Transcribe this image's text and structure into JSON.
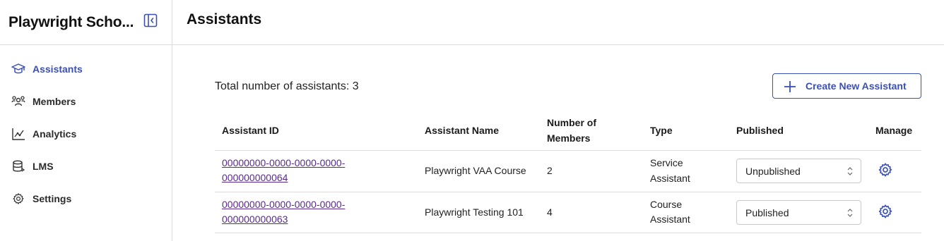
{
  "sidebar": {
    "org_name": "Playwright Scho...",
    "items": [
      {
        "label": "Assistants",
        "icon": "graduation-cap-icon",
        "active": true
      },
      {
        "label": "Members",
        "icon": "users-icon",
        "active": false
      },
      {
        "label": "Analytics",
        "icon": "chart-icon",
        "active": false
      },
      {
        "label": "LMS",
        "icon": "database-icon",
        "active": false
      },
      {
        "label": "Settings",
        "icon": "gear-icon",
        "active": false
      }
    ]
  },
  "header": {
    "title": "Assistants"
  },
  "main": {
    "total_text": "Total number of assistants: 3",
    "create_button_label": "Create New Assistant",
    "table": {
      "headers": {
        "id": "Assistant ID",
        "name": "Assistant Name",
        "members_line1": "Number of",
        "members_line2": "Members",
        "type": "Type",
        "published": "Published",
        "manage": "Manage"
      },
      "rows": [
        {
          "id_line1": "00000000-0000-0000-0000-",
          "id_line2": "000000000064",
          "name": "Playwright VAA Course",
          "members": "2",
          "type_line1": "Service",
          "type_line2": "Assistant",
          "published": "Unpublished"
        },
        {
          "id_line1": "00000000-0000-0000-0000-",
          "id_line2": "000000000063",
          "name": "Playwright Testing 101",
          "members": "4",
          "type_line1": "Course",
          "type_line2": "Assistant",
          "published": "Published"
        }
      ]
    }
  },
  "colors": {
    "accent": "#3b4fb8",
    "link": "#5a2a8a",
    "border": "#dcdcdc"
  }
}
